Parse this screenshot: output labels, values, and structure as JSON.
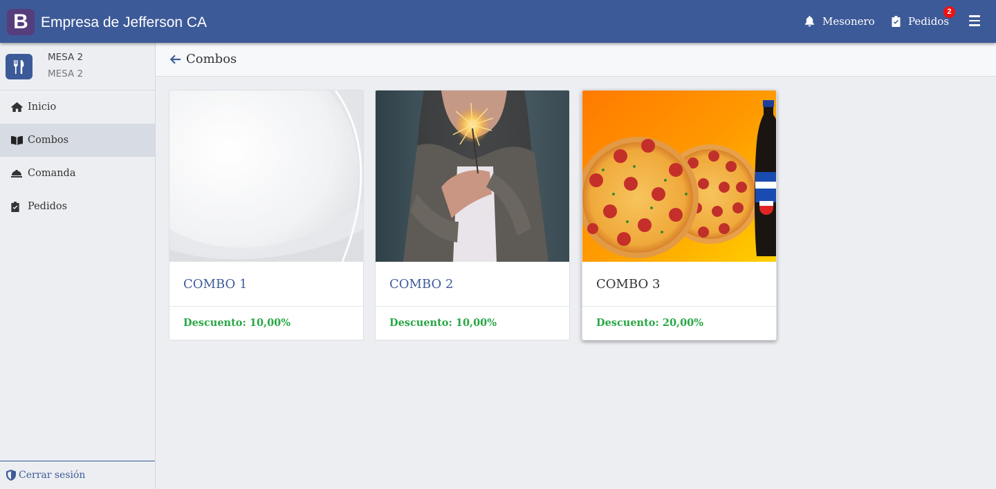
{
  "app": {
    "brand_letter": "B",
    "brand_name": "Empresa de Jefferson CA",
    "colors": {
      "primary": "#3d5a98",
      "brand_logo": "#563d7c",
      "success": "#28a745",
      "badge": "#e11111"
    }
  },
  "topbar": {
    "mesonero": {
      "label": "Mesonero",
      "icon": "bell-icon"
    },
    "pedidos": {
      "label": "Pedidos",
      "icon": "clipboard-check-icon",
      "badge": "2"
    },
    "menu_icon": "hamburger-icon"
  },
  "sidebar": {
    "table": {
      "name": "MESA 2",
      "subtitle": "MESA 2",
      "icon": "utensils-icon"
    },
    "items": [
      {
        "label": "Inicio",
        "icon": "home-icon",
        "active": false
      },
      {
        "label": "Combos",
        "icon": "book-open-icon",
        "active": true
      },
      {
        "label": "Comanda",
        "icon": "concierge-bell-icon",
        "active": false
      },
      {
        "label": "Pedidos",
        "icon": "clipboard-check-icon",
        "active": false
      }
    ],
    "logout": {
      "label": "Cerrar sesión",
      "icon": "shield-icon"
    }
  },
  "header": {
    "title": "Combos",
    "back_icon": "arrow-left-icon"
  },
  "combos": [
    {
      "title": "COMBO 1",
      "discount": "Descuento: 10,00%",
      "image": "abstract-white-background"
    },
    {
      "title": "COMBO 2",
      "discount": "Descuento: 10,00%",
      "image": "person-holding-sparkler"
    },
    {
      "title": "COMBO 3",
      "discount": "Descuento: 20,00%",
      "image": "pizzas-and-soda-bottle"
    }
  ]
}
